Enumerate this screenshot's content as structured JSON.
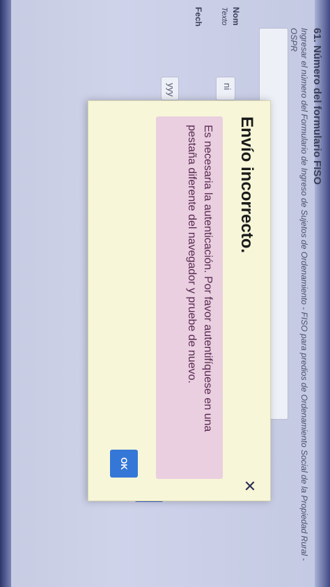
{
  "form": {
    "question_title": "61. Número del formulario FISO",
    "question_description": "Ingresar el número del Formulario de Ingreso de Sujetos de Ordenamiento - FISO para predios de Ordenamiento Social de la Propiedad Rural - OSPR",
    "name_label": "Nom",
    "text_hint": "Texto",
    "name_input_value": "ni",
    "date_label": "Fech",
    "date_input_value": "yyy"
  },
  "dialog": {
    "title": "Envío incorrecto.",
    "message": "Es necesaria la autenticación. Por favor autentifíquese en una pestaña diferente del navegador y pruebe de nuevo.",
    "close_symbol": "✕",
    "ok_label": "OK",
    "colors": {
      "dialog_background": "#f7f6d8",
      "alert_background": "#e9cfe0",
      "alert_text": "#5a2a52",
      "ok_button": "#3577d6"
    }
  },
  "icons": {
    "close": "close-icon",
    "cursor": "mouse-cursor-icon"
  }
}
